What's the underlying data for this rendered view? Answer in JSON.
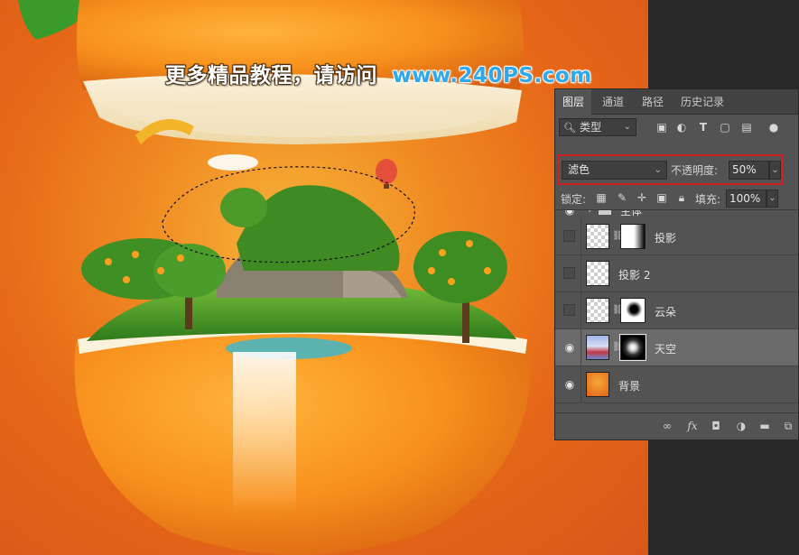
{
  "watermark": {
    "chinese": "更多精品教程，请访问",
    "url": "www.240PS.com"
  },
  "panel": {
    "tabs": [
      "图层",
      "通道",
      "路径",
      "历史记录"
    ],
    "active_tab": "图层",
    "filter": {
      "label": "类型"
    },
    "blend_mode": "滤色",
    "opacity_label": "不透明度:",
    "opacity_value": "50%",
    "lock_label": "锁定:",
    "fill_label": "填充:",
    "fill_value": "100%",
    "group_name": "主体",
    "layers": [
      {
        "name": "投影",
        "visible": false,
        "has_mask": true,
        "selected": false
      },
      {
        "name": "投影 2",
        "visible": false,
        "has_mask": false,
        "selected": false
      },
      {
        "name": "云朵",
        "visible": false,
        "has_mask": true,
        "selected": false
      },
      {
        "name": "天空",
        "visible": true,
        "has_mask": true,
        "selected": true
      },
      {
        "name": "背景",
        "visible": true,
        "has_mask": false,
        "selected": false
      }
    ]
  },
  "colors": {
    "background_orange": "#e2641a",
    "watermark_url": "#2ea9ec",
    "highlight_box": "#cf1f1f",
    "panel_bg": "#535353"
  }
}
